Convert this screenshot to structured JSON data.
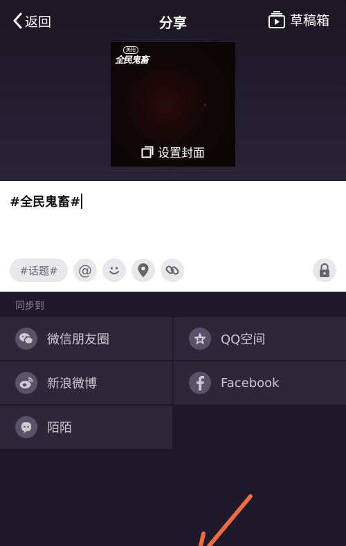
{
  "header": {
    "back_label": "返回",
    "title": "分享",
    "drafts_label": "草稿箱"
  },
  "cover": {
    "logo_top": "美拍",
    "logo_main": "全民鬼畜",
    "set_cover_label": "设置封面"
  },
  "editor": {
    "text": "#全民鬼畜#"
  },
  "toolbar": {
    "topic_label": "#话题#",
    "mention_label": "@"
  },
  "sync": {
    "label": "同步到",
    "items": [
      {
        "label": "微信朋友圈",
        "icon": "wechat-moments-icon"
      },
      {
        "label": "QQ空间",
        "icon": "qzone-icon"
      },
      {
        "label": "新浪微博",
        "icon": "weibo-icon"
      },
      {
        "label": "Facebook",
        "icon": "facebook-icon"
      },
      {
        "label": "陌陌",
        "icon": "momo-icon"
      }
    ]
  },
  "colors": {
    "background": "#1e1a2b",
    "cell": "#2d2838",
    "annotation_arrow": "#f26a3d"
  }
}
